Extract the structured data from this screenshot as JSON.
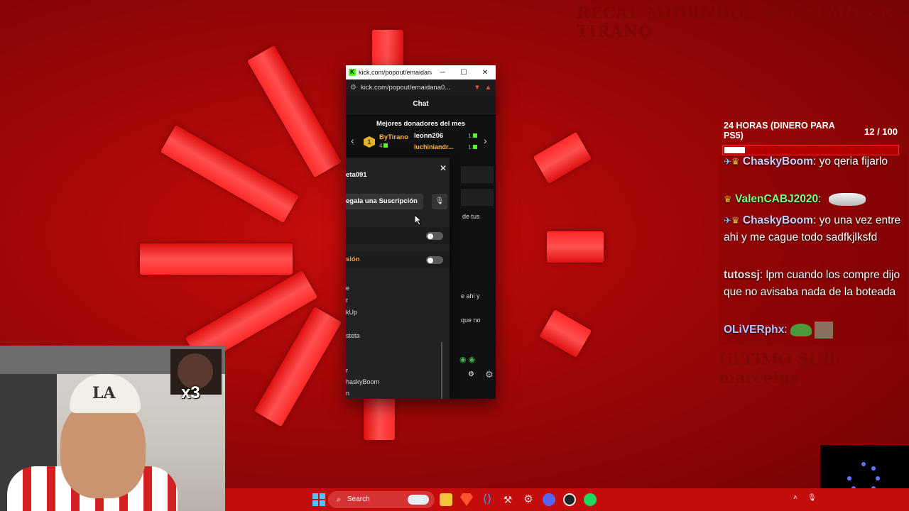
{
  "background": {
    "top_faint_text": "RECAL MIORNDOS SUPREMO - P. TIRANO",
    "bottom_faint_text": "ULTIMO SUB: marcelus"
  },
  "popup": {
    "window_title": "kick.com/popout/emaidana...",
    "url": "kick.com/popout/emaidana0...",
    "window_buttons": {
      "minimize": "─",
      "maximize": "☐",
      "close": "✕"
    },
    "chat_header": "Chat",
    "donors_title": "Mejores donadores del mes",
    "donors": [
      {
        "rank": "1",
        "name": "ByTirano",
        "count": "4"
      },
      {
        "name": "leonn206",
        "count": "1"
      },
      {
        "name": "luchiniandr...",
        "count": "1"
      }
    ],
    "user_card": {
      "close": "✕",
      "username": "eta091",
      "gift_sub": "egala una Suscripción",
      "mute_icon": "🎙",
      "toggle_label_2": "sión",
      "list_items": [
        "e",
        "r",
        "kUp",
        "steta",
        "r",
        "haskyBoom",
        "n"
      ]
    },
    "right_chat_fragments": [
      "de tus",
      "e ahi y",
      "que no"
    ]
  },
  "overlay": {
    "goal_title": "24 HORAS (DINERO PARA PS5)",
    "goal_current": "12",
    "goal_total": "/ 100",
    "goal_progress": 0.12,
    "messages": [
      {
        "user": "ChaskyBoom",
        "user_color": "#c9d1ff",
        "badges": [
          "pin",
          "crown"
        ],
        "text": "yo qeria fijarlo"
      },
      {
        "user": "ValenCABJ2020",
        "user_color": "#7dff7d",
        "badges": [
          "crown"
        ],
        "text": ""
      },
      {
        "user": "ChaskyBoom",
        "user_color": "#c9d1ff",
        "badges": [
          "pin",
          "crown"
        ],
        "text": "yo una vez entre ahi y me cague todo sadfkjlksfd"
      },
      {
        "user": "tutossj",
        "user_color": "#f6dcdc",
        "badges": [],
        "text": "lpm cuando los compre dijo que no avisaba nada de la boteada"
      },
      {
        "user": "OLiVERphx",
        "user_color": "#b8c4ff",
        "badges": [],
        "text": ""
      }
    ]
  },
  "webcam": {
    "cap_logo": "LA",
    "meme_multiplier": "x3"
  },
  "taskbar": {
    "search_placeholder": "Search"
  }
}
